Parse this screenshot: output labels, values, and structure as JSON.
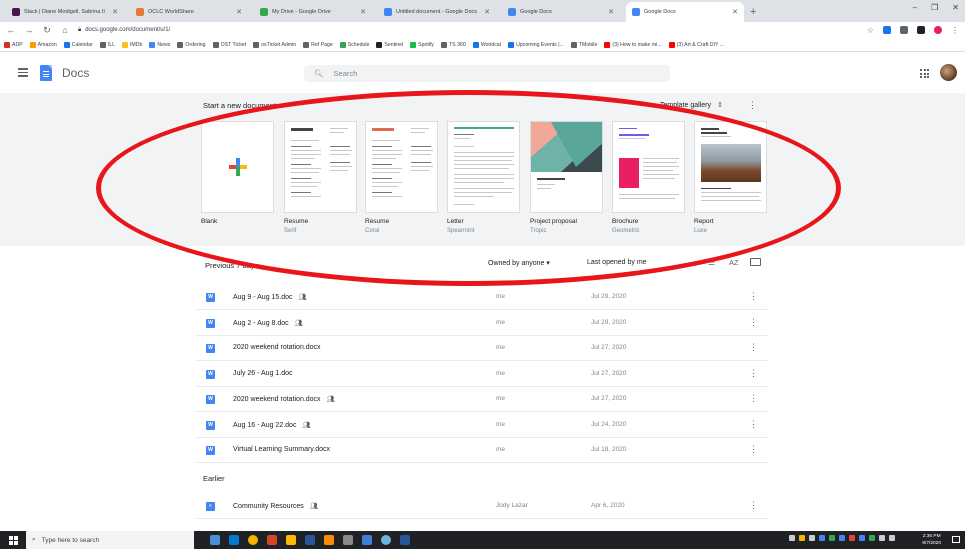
{
  "browser": {
    "tabs": [
      {
        "title": "Slack | Diane Modigell, Sabrina II",
        "color": "#4a154b"
      },
      {
        "title": "OCLC WorldShare",
        "color": "#e07b39"
      },
      {
        "title": "My Drive - Google Drive",
        "color": "#34a853"
      },
      {
        "title": "Untitled document - Google Docs",
        "color": "#4285f4"
      },
      {
        "title": "Google Docs",
        "color": "#4285f4"
      },
      {
        "title": "Google Docs",
        "color": "#4285f4",
        "active": true
      }
    ],
    "new_tab": "+",
    "url": "docs.google.com/document/u/1/",
    "bookmarks": [
      {
        "label": "ADP",
        "color": "#d93025"
      },
      {
        "label": "Amazon",
        "color": "#ff9900"
      },
      {
        "label": "Calendar",
        "color": "#1a73e8"
      },
      {
        "label": "ILL",
        "color": "#5f6368"
      },
      {
        "label": "IMDb",
        "color": "#f5c518"
      },
      {
        "label": "News",
        "color": "#4285f4"
      },
      {
        "label": "Ordering",
        "color": "#5f6368"
      },
      {
        "label": "OST Ticket",
        "color": "#5f6368"
      },
      {
        "label": "osTicket Admin",
        "color": "#5f6368"
      },
      {
        "label": "Ref Page",
        "color": "#5f6368"
      },
      {
        "label": "Schedule",
        "color": "#34a853"
      },
      {
        "label": "Sentinel",
        "color": "#202124"
      },
      {
        "label": "Spotify",
        "color": "#1db954"
      },
      {
        "label": "TS 360",
        "color": "#5f6368"
      },
      {
        "label": "Worldcat",
        "color": "#1a73e8"
      },
      {
        "label": "Upcoming Events |...",
        "color": "#1a73e8"
      },
      {
        "label": "TMobile",
        "color": "#5f6368"
      },
      {
        "label": "(3) How to make mi...",
        "color": "#ff0000"
      },
      {
        "label": "(3) Art & Craft DIY ...",
        "color": "#ff0000"
      }
    ]
  },
  "docs": {
    "app_title": "Docs",
    "search_placeholder": "Search",
    "start_new": "Start a new document",
    "template_gallery": "Template gallery",
    "templates": [
      {
        "label": "Blank",
        "sub": "",
        "kind": "blank"
      },
      {
        "label": "Resume",
        "sub": "Serif",
        "kind": "resume-serif"
      },
      {
        "label": "Resume",
        "sub": "Coral",
        "kind": "resume-coral"
      },
      {
        "label": "Letter",
        "sub": "Spearmint",
        "kind": "letter"
      },
      {
        "label": "Project proposal",
        "sub": "Tropic",
        "kind": "proposal"
      },
      {
        "label": "Brochure",
        "sub": "Geometric",
        "kind": "brochure"
      },
      {
        "label": "Report",
        "sub": "Luxe",
        "kind": "report"
      }
    ],
    "list": {
      "title": "Previous 7 days",
      "owned_filter": "Owned by anyone",
      "sort": "Last opened by me",
      "sort_icon": "AZ",
      "rows": [
        {
          "name": "Aug 9 - Aug 15.doc",
          "shared": true,
          "owner": "me",
          "date": "Jul 29, 2020",
          "type": "W"
        },
        {
          "name": "Aug 2 - Aug 8.doc",
          "shared": true,
          "owner": "me",
          "date": "Jul 29, 2020",
          "type": "W"
        },
        {
          "name": "2020 weekend rotation.docx",
          "shared": false,
          "owner": "me",
          "date": "Jul 27, 2020",
          "type": "W"
        },
        {
          "name": "July 26 - Aug 1.doc",
          "shared": false,
          "owner": "me",
          "date": "Jul 27, 2020",
          "type": "W"
        },
        {
          "name": "2020 weekend rotation.docx",
          "shared": true,
          "owner": "me",
          "date": "Jul 27, 2020",
          "type": "W"
        },
        {
          "name": "Aug 16 - Aug 22.doc",
          "shared": true,
          "owner": "me",
          "date": "Jul 24, 2020",
          "type": "W"
        },
        {
          "name": "Virtual Learning Summary.docx",
          "shared": false,
          "owner": "me",
          "date": "Jul 18, 2020",
          "type": "W"
        }
      ],
      "earlier_title": "Earlier",
      "earlier_rows": [
        {
          "name": "Community Resources",
          "shared": true,
          "owner": "Jody Lazar",
          "date": "Apr 6, 2020",
          "type": "≡"
        }
      ]
    }
  },
  "taskbar": {
    "search_placeholder": "Type here to search",
    "time": "2:36 PM",
    "date": "8/7/2020"
  }
}
